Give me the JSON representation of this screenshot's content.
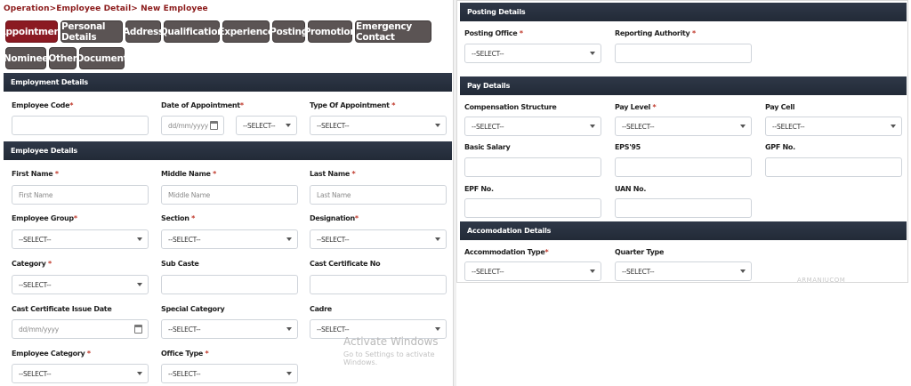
{
  "breadcrumb": "Operation>Employee Detail> New Employee",
  "tabs": [
    "Appointment",
    "Personal Details",
    "Address",
    "Qualification",
    "Experience",
    "Posting",
    "Promotion",
    "Emergency Contact",
    "Nominee",
    "Other",
    "Document"
  ],
  "active_tab": "Appointment",
  "colors": {
    "active_tab": "#8b1a22",
    "tab": "#5b5454",
    "section_bar": "#2a3240",
    "required": "#c0392b",
    "breadcrumb": "#8b1a1a"
  },
  "employment": {
    "title": "Employment Details",
    "employee_code_label": "Employee Code",
    "date_of_appointment_label": "Date of Appointment",
    "date_placeholder": "dd/mm/yyyy",
    "date_select_value": "--SELECT--",
    "type_of_appointment_label": "Type Of Appointment ",
    "type_value": "--SELECT--"
  },
  "employee": {
    "title": "Employee Details",
    "first_name_label": "First Name ",
    "first_name_placeholder": "First Name",
    "middle_name_label": "Middle Name ",
    "middle_name_placeholder": "Middle Name",
    "last_name_label": "Last Name ",
    "last_name_placeholder": "Last Name",
    "employee_group_label": "Employee Group",
    "employee_group_value": "--SELECT--",
    "section_label": "Section ",
    "section_value": "--SELECT--",
    "designation_label": "Designation",
    "designation_value": "--SELECT--",
    "category_label": "Category ",
    "category_value": "--SELECT--",
    "sub_caste_label": "Sub Caste",
    "cast_certificate_label": "Cast Certificate No",
    "cast_issue_date_label": "Cast Certificate Issue Date",
    "cast_issue_date_placeholder": "dd/mm/yyyy",
    "special_category_label": "Special Category",
    "special_category_value": "--SELECT--",
    "cadre_label": "Cadre",
    "cadre_value": "--SELECT--",
    "employee_category_label": "Employee Category ",
    "employee_category_value": "--SELECT--",
    "office_type_label": "Office Type ",
    "office_type_value": "--SELECT--"
  },
  "posting": {
    "title": "Posting Details",
    "posting_office_label": "Posting Office ",
    "posting_office_value": "--SELECT--",
    "reporting_authority_label": "Reporting Authority "
  },
  "pay": {
    "title": "Pay Details",
    "compensation_label": "Compensation Structure",
    "compensation_value": "--SELECT--",
    "pay_level_label": "Pay Level ",
    "pay_level_value": "--SELECT--",
    "pay_cell_label": "Pay Cell",
    "pay_cell_value": "--SELECT--",
    "basic_salary_label": "Basic Salary",
    "eps_label": "EPS'95",
    "gpf_label": "GPF No.",
    "epf_label": "EPF No.",
    "uan_label": "UAN No."
  },
  "accommodation": {
    "title": "Accomodation Details",
    "type_label": "Accommodation Type",
    "type_value": "--SELECT--",
    "quarter_label": "Quarter Type",
    "quarter_value": "--SELECT--"
  },
  "watermark": {
    "line1": "Activate Windows",
    "line2": "Go to Settings to activate Windows."
  },
  "faint_text": "ARMANIUCOM"
}
